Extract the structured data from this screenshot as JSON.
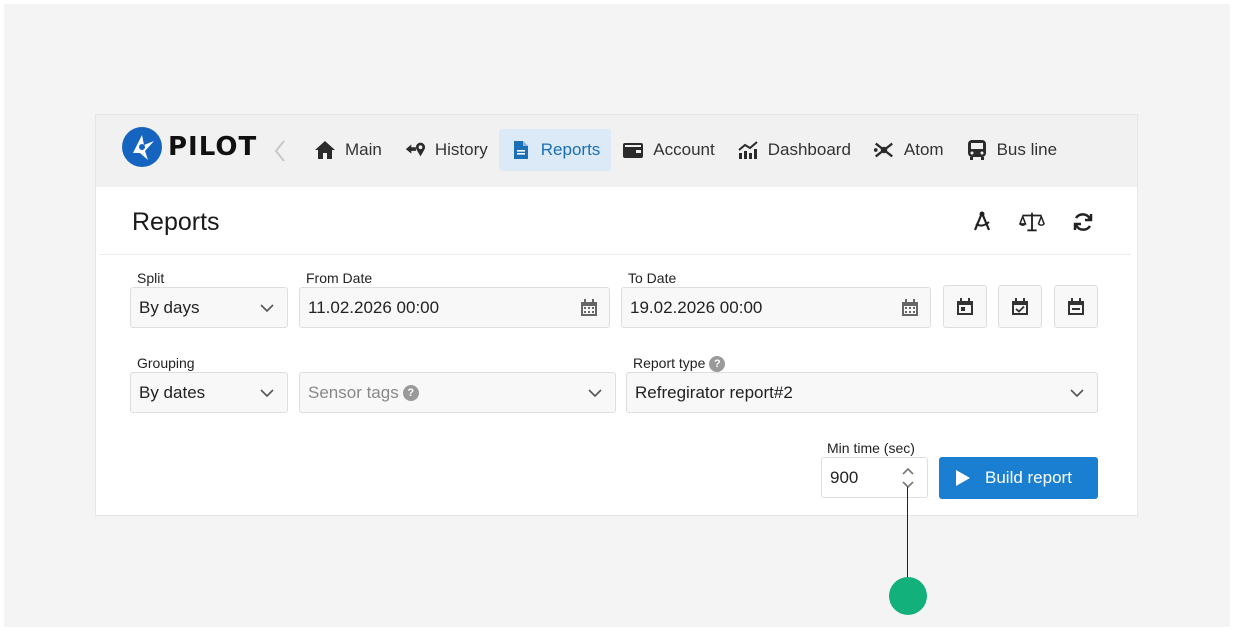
{
  "brand": {
    "name": "PILOT",
    "color": "#1565c0"
  },
  "nav": {
    "back_icon": "chevron-left-icon",
    "items": [
      {
        "label": "Main",
        "icon": "home-icon",
        "active": false
      },
      {
        "label": "History",
        "icon": "history-route-icon",
        "active": false
      },
      {
        "label": "Reports",
        "icon": "document-icon",
        "active": true
      },
      {
        "label": "Account",
        "icon": "wallet-icon",
        "active": false
      },
      {
        "label": "Dashboard",
        "icon": "dashboard-chart-icon",
        "active": false
      },
      {
        "label": "Atom",
        "icon": "atom-icon",
        "active": false
      },
      {
        "label": "Bus line",
        "icon": "bus-icon",
        "active": false
      }
    ]
  },
  "panel": {
    "title": "Reports",
    "header_icons": [
      "compass-drawing-icon",
      "scales-icon",
      "refresh-icon"
    ]
  },
  "form": {
    "split": {
      "label": "Split",
      "value": "By days"
    },
    "from_date": {
      "label": "From Date",
      "value": "11.02.2026 00:00"
    },
    "to_date": {
      "label": "To Date",
      "value": "19.02.2026 00:00"
    },
    "quick_date_buttons": [
      "calendar-day-icon",
      "calendar-check-icon",
      "calendar-minus-icon"
    ],
    "grouping": {
      "label": "Grouping",
      "value": "By dates"
    },
    "sensor_tags": {
      "placeholder": "Sensor tags"
    },
    "report_type": {
      "label": "Report type",
      "value": "Refregirator report#2"
    },
    "min_time": {
      "label": "Min time (sec)",
      "value": "900"
    },
    "help_badge": "?",
    "build_button": "Build report"
  },
  "colors": {
    "accent": "#1a7fd0",
    "active_tab_bg": "#dceaf7",
    "callout": "#12b07a"
  }
}
